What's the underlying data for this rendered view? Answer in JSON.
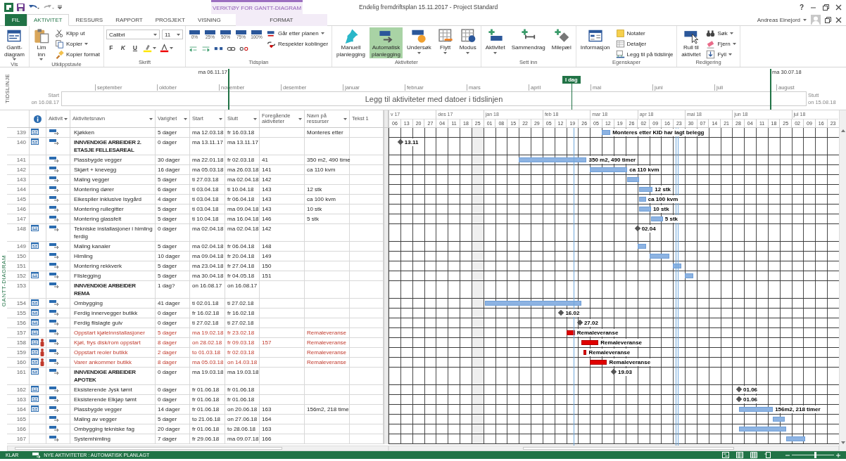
{
  "title_bar": {
    "context_group": "VERKTØY FOR GANTT-DIAGRAM",
    "title": "Endelig fremdriftsplan 15.11.2017 - Project Standard",
    "help": "?"
  },
  "tabs": [
    {
      "label": "FIL",
      "kind": "file",
      "selected": false
    },
    {
      "label": "AKTIVITET",
      "kind": "tab",
      "selected": true
    },
    {
      "label": "RESSURS",
      "kind": "tab",
      "selected": false
    },
    {
      "label": "RAPPORT",
      "kind": "tab",
      "selected": false
    },
    {
      "label": "PROSJEKT",
      "kind": "tab",
      "selected": false
    },
    {
      "label": "VISNING",
      "kind": "tab",
      "selected": false
    },
    {
      "label": "FORMAT",
      "kind": "context",
      "selected": false
    }
  ],
  "user": {
    "name": "Andreas Einejord"
  },
  "ribbon": {
    "groups": [
      {
        "label": "Vis",
        "items": [
          {
            "kind": "large",
            "label": "Gantt-\ndiagram",
            "dropdown": true
          }
        ]
      },
      {
        "label": "Utklippstavle",
        "items": [
          {
            "kind": "large",
            "label": "Lim\ninn",
            "dropdown": true
          },
          {
            "kind": "stack",
            "items": [
              {
                "label": "Klipp ut"
              },
              {
                "label": "Kopier",
                "dropdown": true
              },
              {
                "label": "Kopier format"
              }
            ]
          }
        ]
      },
      {
        "label": "Skrift",
        "items": [
          {
            "kind": "font",
            "font": "Calibri",
            "size": "11",
            "buttons": [
              "F",
              "K",
              "U"
            ]
          }
        ]
      },
      {
        "label": "Tidsplan",
        "items": [
          {
            "kind": "percent",
            "labels": [
              "0%",
              "25%",
              "50%",
              "75%",
              "100%"
            ]
          },
          {
            "kind": "stack",
            "items": [
              {
                "label": "Går etter planen",
                "dropdown": true
              },
              {
                "label": "Respekter koblinger"
              }
            ]
          }
        ]
      },
      {
        "label": "Aktiviteter",
        "items": [
          {
            "kind": "large",
            "label": "Manuell\nplanlegging",
            "selected": false
          },
          {
            "kind": "large",
            "label": "Automatisk\nplanlegging",
            "selected": true
          },
          {
            "kind": "large",
            "label": "Undersøk",
            "dropdown": true
          },
          {
            "kind": "large",
            "label": "Flytt",
            "dropdown": true
          },
          {
            "kind": "large",
            "label": "Modus",
            "dropdown": true
          }
        ]
      },
      {
        "label": "Sett inn",
        "items": [
          {
            "kind": "large",
            "label": "Aktivitet",
            "dropdown": true
          },
          {
            "kind": "large",
            "label": "Sammendrag"
          },
          {
            "kind": "large",
            "label": "Milepæl"
          }
        ]
      },
      {
        "label": "Egenskaper",
        "items": [
          {
            "kind": "large",
            "label": "Informasjon"
          },
          {
            "kind": "stack",
            "items": [
              {
                "label": "Notater"
              },
              {
                "label": "Detaljer"
              },
              {
                "label": "Legg til på tidslinje"
              }
            ]
          }
        ]
      },
      {
        "label": "Redigering",
        "items": [
          {
            "kind": "large",
            "label": "Rull til\naktivitet"
          },
          {
            "kind": "stack",
            "items": [
              {
                "label": "Søk",
                "dropdown": true
              },
              {
                "label": "Fjern",
                "dropdown": true
              },
              {
                "label": "Fyll",
                "dropdown": true
              }
            ]
          }
        ]
      }
    ]
  },
  "timeline": {
    "label": "TIDSLINJE",
    "view_start": "ma 06.11.17",
    "view_end": "ma 30.07.18",
    "today": "I dag",
    "start_label": "Start",
    "start_date": "on 16.08.17",
    "finish_label": "Stutt",
    "finish_date": "on 15.08.18",
    "placeholder": "Legg til aktiviteter med datoer i tidslinjen",
    "months": [
      "september",
      "oktober",
      "november",
      "desember",
      "januar",
      "februar",
      "mars",
      "april",
      "mai",
      "juni",
      "juli",
      "august"
    ]
  },
  "view_label": "GANTT-DIAGRAM",
  "table": {
    "columns": [
      {
        "label": "Aktivit",
        "dropdown": true
      },
      {
        "label": "Aktivitetsnavn",
        "dropdown": true
      },
      {
        "label": "Varighet",
        "dropdown": true
      },
      {
        "label": "Start",
        "dropdown": true
      },
      {
        "label": "Slutt",
        "dropdown": true
      },
      {
        "label": "Foregående aktiviteter",
        "dropdown": true
      },
      {
        "label": "Navn på ressurser",
        "dropdown": true
      },
      {
        "label": "Tekst 1"
      }
    ],
    "rows": [
      {
        "id": "139",
        "indicator": true,
        "name": "Kjøkken",
        "duration": "5 dager",
        "start": "ma 12.03.18",
        "finish": "fr 16.03.18",
        "resources": "Monteres etter",
        "bar": {
          "kind": "task",
          "label": "Monteres etter KID har lagt belegg"
        }
      },
      {
        "id": "140",
        "indicator": true,
        "summary": true,
        "name": "INNVENDIGE ARBEIDER 2. ETASJE FELLESAREAL",
        "duration": "0 dager",
        "start": "ma 13.11.17",
        "finish": "ma 13.11.17",
        "bar": {
          "kind": "milestone",
          "label": "13.11"
        }
      },
      {
        "id": "141",
        "name": "Plassbygde vegger",
        "duration": "30 dager",
        "start": "ma 22.01.18",
        "finish": "fr 02.03.18",
        "predecessors": "41",
        "resources": "350 m2, 490 time",
        "bar": {
          "kind": "task",
          "label": "350 m2, 490 timer"
        }
      },
      {
        "id": "142",
        "name": "Skjørt + knevegg",
        "duration": "16 dager",
        "start": "ma 05.03.18",
        "finish": "ma 26.03.18",
        "predecessors": "141",
        "resources": "ca 110 kvm",
        "bar": {
          "kind": "task",
          "label": "ca 110 kvm"
        }
      },
      {
        "id": "143",
        "name": "Maling vegger",
        "duration": "5 dager",
        "start": "ti 27.03.18",
        "finish": "ma 02.04.18",
        "predecessors": "142",
        "bar": {
          "kind": "task"
        }
      },
      {
        "id": "144",
        "name": "Montering dører",
        "duration": "6 dager",
        "start": "ti 03.04.18",
        "finish": "ti 10.04.18",
        "predecessors": "143",
        "resources": "12 stk",
        "bar": {
          "kind": "task",
          "label": "12 stk"
        }
      },
      {
        "id": "145",
        "name": "Eikespiler inklusive Isygård",
        "duration": "4 dager",
        "start": "ti 03.04.18",
        "finish": "fr 06.04.18",
        "predecessors": "143",
        "resources": "ca 100 kvm",
        "bar": {
          "kind": "task",
          "label": "ca 100 kvm"
        }
      },
      {
        "id": "146",
        "name": "Montering rullegitter",
        "duration": "5 dager",
        "start": "ti 03.04.18",
        "finish": "ma 09.04.18",
        "predecessors": "143",
        "resources": "10 stk",
        "bar": {
          "kind": "task",
          "label": "10 stk"
        }
      },
      {
        "id": "147",
        "name": "Montering glassfelt",
        "duration": "5 dager",
        "start": "ti 10.04.18",
        "finish": "ma 16.04.18",
        "predecessors": "146",
        "resources": "5 stk",
        "bar": {
          "kind": "task",
          "label": "5 stk"
        }
      },
      {
        "id": "148",
        "indicator": true,
        "name": "Tekniske installasjoner i himling ferdig",
        "duration": "0 dager",
        "start": "ma 02.04.18",
        "finish": "ma 02.04.18",
        "predecessors": "142",
        "bar": {
          "kind": "milestone",
          "label": "02.04"
        }
      },
      {
        "id": "149",
        "indicator": true,
        "name": "Maling kanaler",
        "duration": "5 dager",
        "start": "ma 02.04.18",
        "finish": "fr 06.04.18",
        "predecessors": "148",
        "bar": {
          "kind": "task"
        }
      },
      {
        "id": "150",
        "name": "Himling",
        "duration": "10 dager",
        "start": "ma 09.04.18",
        "finish": "fr 20.04.18",
        "predecessors": "149",
        "bar": {
          "kind": "task"
        }
      },
      {
        "id": "151",
        "name": "Montering rekkverk",
        "duration": "5 dager",
        "start": "ma 23.04.18",
        "finish": "fr 27.04.18",
        "predecessors": "150",
        "bar": {
          "kind": "task"
        }
      },
      {
        "id": "152",
        "indicator": true,
        "name": "Flislegging",
        "duration": "5 dager",
        "start": "ma 30.04.18",
        "finish": "fr 04.05.18",
        "predecessors": "151",
        "bar": {
          "kind": "task"
        }
      },
      {
        "id": "153",
        "summary": true,
        "name": "INNVENDIGE ARBEIDER REMA",
        "duration": "1 dag?",
        "start": "on 16.08.17",
        "finish": "on 16.08.17"
      },
      {
        "id": "154",
        "indicator": true,
        "name": "Ombygging",
        "duration": "41 dager",
        "start": "ti 02.01.18",
        "finish": "ti 27.02.18",
        "bar": {
          "kind": "task"
        }
      },
      {
        "id": "155",
        "indicator": true,
        "name": "Ferdig innervegger butikk",
        "duration": "0 dager",
        "start": "fr 16.02.18",
        "finish": "fr 16.02.18",
        "bar": {
          "kind": "milestone",
          "label": "16.02"
        }
      },
      {
        "id": "156",
        "indicator": true,
        "name": "Ferdig flislagte gulv",
        "duration": "0 dager",
        "start": "ti 27.02.18",
        "finish": "ti 27.02.18",
        "bar": {
          "kind": "milestone",
          "label": "27.02"
        }
      },
      {
        "id": "157",
        "indicator": true,
        "flagged": true,
        "name": "Oppstart kjøleinnstallasjoner",
        "duration": "5 dager",
        "start": "ma 19.02.18",
        "finish": "fr 23.02.18",
        "resources": "Remaleveranse",
        "bar": {
          "kind": "task",
          "label": "Remaleveranse"
        }
      },
      {
        "id": "158",
        "indicator": true,
        "person": true,
        "flagged": true,
        "name": "Kjøl, frys disk/rom oppstart",
        "duration": "8 dager",
        "start": "on 28.02.18",
        "finish": "fr 09.03.18",
        "predecessors": "157",
        "resources": "Remaleveranse",
        "bar": {
          "kind": "task",
          "label": "Remaleveranse"
        }
      },
      {
        "id": "159",
        "indicator": true,
        "person": true,
        "flagged": true,
        "name": "Oppstart reoler butikk",
        "duration": "2 dager",
        "start": "to 01.03.18",
        "finish": "fr 02.03.18",
        "resources": "Remaleveranse",
        "bar": {
          "kind": "task",
          "label": "Remaleveranse"
        }
      },
      {
        "id": "160",
        "indicator": true,
        "person": true,
        "flagged": true,
        "name": "Varer ankommer butikk",
        "duration": "8 dager",
        "start": "ma 05.03.18",
        "finish": "on 14.03.18",
        "resources": "Remaleveranse",
        "bar": {
          "kind": "task",
          "label": "Remaleveranse"
        }
      },
      {
        "id": "161",
        "indicator": true,
        "summary": true,
        "name": "INNVENDIGE ARBEIDER APOTEK",
        "duration": "0 dager",
        "start": "ma 19.03.18",
        "finish": "ma 19.03.18",
        "bar": {
          "kind": "milestone",
          "label": "19.03"
        }
      },
      {
        "id": "162",
        "indicator": true,
        "name": "Eksisterende Jysk tømt",
        "duration": "0 dager",
        "start": "fr 01.06.18",
        "finish": "fr 01.06.18",
        "bar": {
          "kind": "milestone",
          "label": "01.06"
        }
      },
      {
        "id": "163",
        "indicator": true,
        "name": "Eksisterende Elkjøp tømt",
        "duration": "0 dager",
        "start": "fr 01.06.18",
        "finish": "fr 01.06.18",
        "bar": {
          "kind": "milestone",
          "label": "01.06"
        }
      },
      {
        "id": "164",
        "indicator": true,
        "name": "Plassbygde vegger",
        "duration": "14 dager",
        "start": "fr 01.06.18",
        "finish": "on 20.06.18",
        "predecessors": "163",
        "resources": "156m2, 218 time",
        "bar": {
          "kind": "task",
          "label": "156m2, 218 timer"
        }
      },
      {
        "id": "165",
        "name": "Maling av vegger",
        "duration": "5 dager",
        "start": "to 21.06.18",
        "finish": "on 27.06.18",
        "predecessors": "164",
        "bar": {
          "kind": "task"
        }
      },
      {
        "id": "166",
        "name": "Ombygging tekniske fag",
        "duration": "20 dager",
        "start": "fr 01.06.18",
        "finish": "to 28.06.18",
        "predecessors": "163",
        "bar": {
          "kind": "task"
        }
      },
      {
        "id": "167",
        "name": "Systemhimling",
        "duration": "7 dager",
        "start": "fr 29.06.18",
        "finish": "ma 09.07.18",
        "predecessors": "166",
        "bar": {
          "kind": "task"
        }
      }
    ]
  },
  "gantt": {
    "months": [
      {
        "label": "v 17",
        "weeks": [
          "06",
          "13",
          "20",
          "27"
        ]
      },
      {
        "label": "des 17",
        "weeks": [
          "04",
          "11",
          "18",
          "25"
        ]
      },
      {
        "label": "jan 18",
        "weeks": [
          "01",
          "08",
          "15",
          "22",
          "29"
        ]
      },
      {
        "label": "feb 18",
        "weeks": [
          "05",
          "12",
          "19",
          "26"
        ]
      },
      {
        "label": "mar 18",
        "weeks": [
          "05",
          "12",
          "19",
          "26"
        ]
      },
      {
        "label": "apr 18",
        "weeks": [
          "02",
          "09",
          "16",
          "23"
        ]
      },
      {
        "label": "mai 18",
        "weeks": [
          "30",
          "07",
          "14",
          "21"
        ]
      },
      {
        "label": "jun 18",
        "weeks": [
          "28",
          "04",
          "11",
          "18",
          "25"
        ]
      },
      {
        "label": "jul 18",
        "weeks": [
          "02",
          "09",
          "16",
          "23"
        ]
      }
    ]
  },
  "status_bar": {
    "ready": "KLAR",
    "mode": "NYE AKTIVITETER : AUTOMATISK PLANLAGT",
    "zoom": {
      "level": 0.55
    }
  }
}
